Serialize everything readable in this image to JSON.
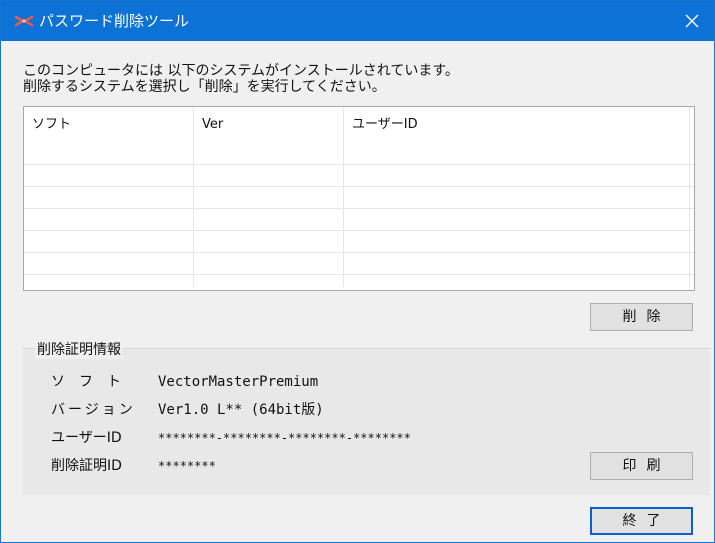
{
  "window": {
    "title": "パスワード削除ツール",
    "close_symbol": "×"
  },
  "description": {
    "line1": "このコンピュータには 以下のシステムがインストールされています。",
    "line2": "削除するシステムを選択し「削除」を実行してください。"
  },
  "list": {
    "columns": [
      "ソフト",
      "Ver",
      "ユーザーID"
    ],
    "rows": []
  },
  "buttons": {
    "delete": "削除",
    "print": "印刷",
    "exit": "終了"
  },
  "certificate": {
    "group_title": "削除証明情報",
    "software_label": "ソフト",
    "software_value": "VectorMasterPremium",
    "version_label": "バージョン",
    "version_value": "Ver1.0 L** (64bit版)",
    "userid_label": "ユーザーID",
    "userid_value": "********-********-********-********",
    "certid_label": "削除証明ID",
    "certid_value": "********"
  },
  "colors": {
    "titlebar": "#0c72d6",
    "default_button_border": "#0b5fc7"
  }
}
